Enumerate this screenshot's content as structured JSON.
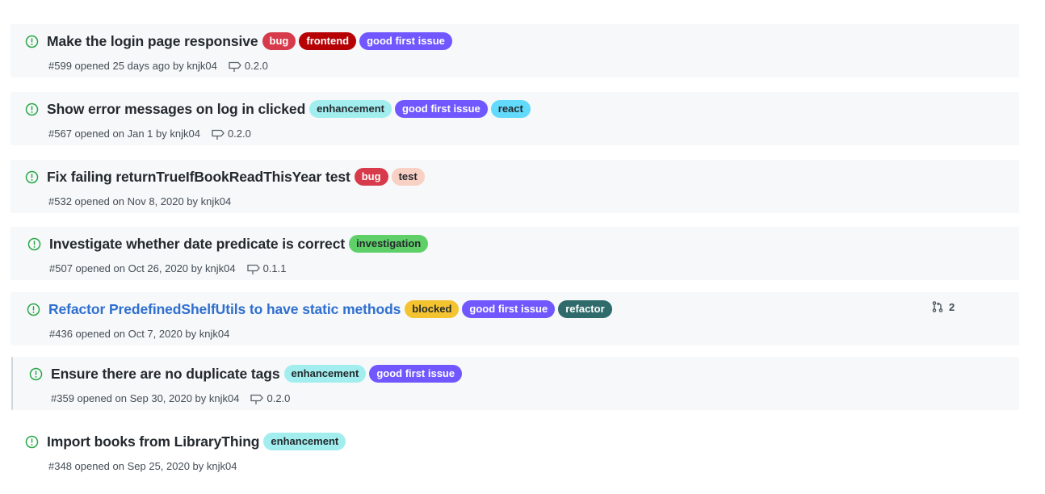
{
  "colors": {
    "open_icon": "#28a745",
    "row_bg": "#f6f8fa",
    "link_title": "#2f6fcf"
  },
  "labels_palette": {
    "bug": {
      "bg": "#d73a4a",
      "fg": "#ffffff"
    },
    "frontend": {
      "bg": "#b60205",
      "fg": "#ffffff"
    },
    "good first issue": {
      "bg": "#7057ff",
      "fg": "#ffffff"
    },
    "enhancement": {
      "bg": "#a2eeef",
      "fg": "#24292e"
    },
    "react": {
      "bg": "#61dafb",
      "fg": "#24292e"
    },
    "test": {
      "bg": "#f9d0c4",
      "fg": "#24292e"
    },
    "investigation": {
      "bg": "#5fd068",
      "fg": "#24292e"
    },
    "blocked": {
      "bg": "#f4c430",
      "fg": "#24292e"
    },
    "refactor": {
      "bg": "#2f6b6b",
      "fg": "#ffffff"
    }
  },
  "issues": [
    {
      "title": "Make the login page responsive",
      "labels": [
        "bug",
        "frontend",
        "good first issue"
      ],
      "meta": "#599 opened 25 days ago by knjk04",
      "milestone": "0.2.0",
      "icon": "issue-opened-icon"
    },
    {
      "title": "Show error messages on log in clicked",
      "labels": [
        "enhancement",
        "good first issue",
        "react"
      ],
      "meta": "#567 opened on Jan 1 by knjk04",
      "milestone": "0.2.0",
      "icon": "issue-opened-icon"
    },
    {
      "title": "Fix failing returnTrueIfBookReadThisYear test",
      "labels": [
        "bug",
        "test"
      ],
      "meta": "#532 opened on Nov 8, 2020 by knjk04",
      "milestone": "",
      "icon": "issue-opened-icon"
    },
    {
      "title": "Investigate whether date predicate is correct",
      "labels": [
        "investigation"
      ],
      "meta": "#507 opened on Oct 26, 2020 by knjk04",
      "milestone": "0.1.1",
      "icon": "issue-opened-icon"
    },
    {
      "title": "Refactor PredefinedShelfUtils to have static methods",
      "labels": [
        "blocked",
        "good first issue",
        "refactor"
      ],
      "meta": "#436 opened on Oct 7, 2020 by knjk04",
      "milestone": "",
      "linked_prs": "2",
      "icon": "issue-opened-icon"
    },
    {
      "title": "Ensure there are no duplicate tags",
      "labels": [
        "enhancement",
        "good first issue"
      ],
      "meta": "#359 opened on Sep 30, 2020 by knjk04",
      "milestone": "0.2.0",
      "icon": "issue-opened-icon"
    },
    {
      "title": "Import books from LibraryThing",
      "labels": [
        "enhancement"
      ],
      "meta": "#348 opened on Sep 25, 2020 by knjk04",
      "milestone": "",
      "icon": "issue-opened-icon"
    }
  ]
}
